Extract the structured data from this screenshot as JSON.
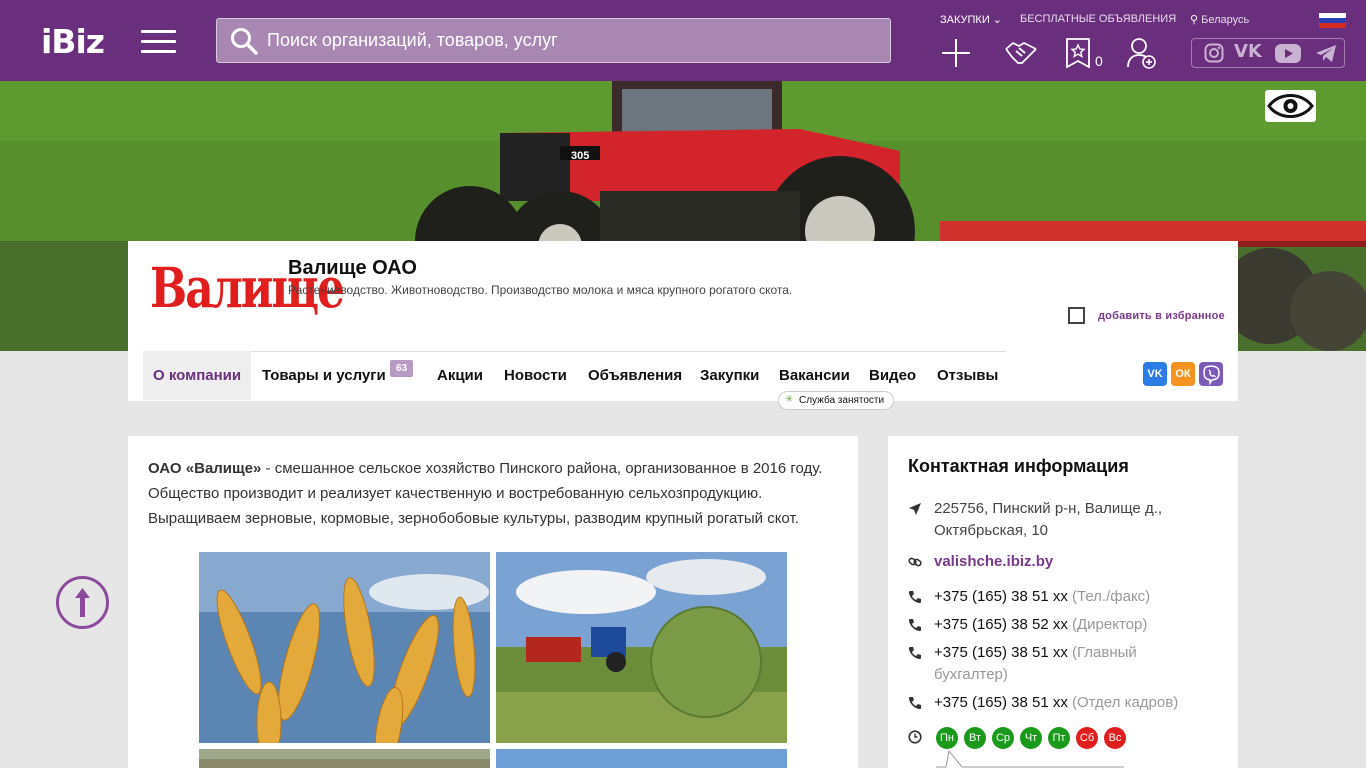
{
  "header": {
    "logo": "iBiz",
    "search_placeholder": "Поиск организаций, товаров, услуг",
    "link_purchases": "ЗАКУПКИ",
    "link_free_ads": "БЕСПЛАТНЫЕ ОБЪЯВЛЕНИЯ",
    "location": "Беларусь",
    "favorites_count": "0",
    "icons": [
      "menu-icon",
      "search-icon",
      "plus-icon",
      "handshake-icon",
      "star-icon",
      "user-add-icon",
      "instagram-icon",
      "vk-icon",
      "youtube-icon",
      "telegram-icon"
    ]
  },
  "company": {
    "logo_text": "Валище",
    "name": "Валище ОАО",
    "description": "Растениеводство. Животноводство. Производство молока и мяса крупного рогатого скота.",
    "favorite_label": "добавить в избранное"
  },
  "tabs": [
    {
      "label": "О компании"
    },
    {
      "label": "Товары и услуги",
      "count": "63"
    },
    {
      "label": "Акции"
    },
    {
      "label": "Новости"
    },
    {
      "label": "Объявления"
    },
    {
      "label": "Закупки"
    },
    {
      "label": "Вакансии"
    },
    {
      "label": "Видео"
    },
    {
      "label": "Отзывы"
    }
  ],
  "tooltip": "Служба занятости",
  "about": {
    "name_bold": "ОАО «Валище»",
    "text_1": " - смешанное сельское хозяйство Пинского района, организованное в 2016 году. Общество производит и реализует качественную и востребованную сельхозпродукцию. Выращиваем зерновые, кормовые, зернобобовые культуры, разводим крупный рогатый скот."
  },
  "contacts": {
    "title": "Контактная информация",
    "address": "225756, Пинский р-н, Валище д., Октябрьская, 10",
    "website": "valishche.ibiz.by",
    "phones": [
      {
        "number": "+375 (165) 38 51 xx",
        "label": "(Тел./факс)"
      },
      {
        "number": "+375 (165) 38 52 xx",
        "label": "(Директор)"
      },
      {
        "number": "+375 (165) 38 51 xx",
        "label": "(Главный бухгалтер)"
      },
      {
        "number": "+375 (165) 38 51 xx",
        "label": "(Отдел кадров)"
      }
    ],
    "days": [
      {
        "label": "Пн",
        "color": "#1a9a1a"
      },
      {
        "label": "Вт",
        "color": "#1a9a1a"
      },
      {
        "label": "Ср",
        "color": "#1a9a1a"
      },
      {
        "label": "Чт",
        "color": "#1a9a1a"
      },
      {
        "label": "Пт",
        "color": "#1a9a1a"
      },
      {
        "label": "Сб",
        "color": "#e01e1e"
      },
      {
        "label": "Вс",
        "color": "#e01e1e"
      }
    ]
  },
  "colors": {
    "brand": "#6a2f7c",
    "link": "#7a3a8c"
  }
}
